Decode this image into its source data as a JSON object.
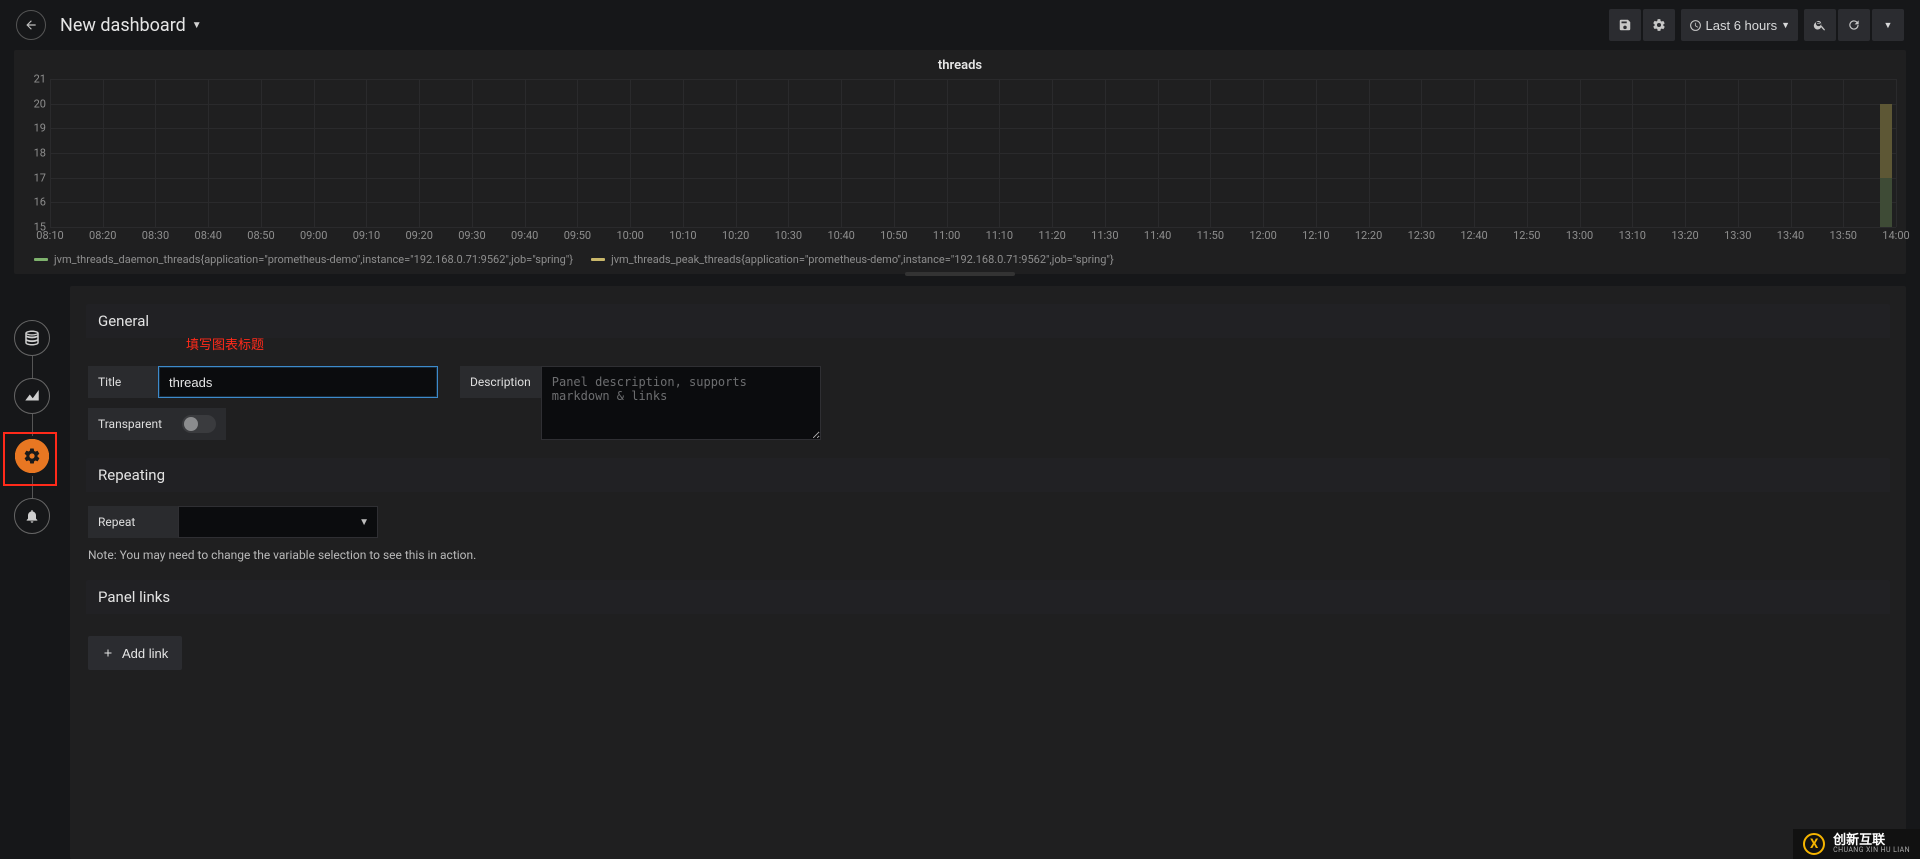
{
  "header": {
    "dashboard_title": "New dashboard",
    "save_tooltip": "Save",
    "settings_tooltip": "Settings",
    "time_range_label": "Last 6 hours",
    "zoom_out_tooltip": "Zoom out",
    "refresh_tooltip": "Refresh"
  },
  "chart_data": {
    "type": "bar",
    "title": "threads",
    "ylabel": "",
    "ylim": [
      15,
      21
    ],
    "y_ticks": [
      15,
      16,
      17,
      18,
      19,
      20,
      21
    ],
    "x_ticks": [
      "08:10",
      "08:20",
      "08:30",
      "08:40",
      "08:50",
      "09:00",
      "09:10",
      "09:20",
      "09:30",
      "09:40",
      "09:50",
      "10:00",
      "10:10",
      "10:20",
      "10:30",
      "10:40",
      "10:50",
      "11:00",
      "11:10",
      "11:20",
      "11:30",
      "11:40",
      "11:50",
      "12:00",
      "12:10",
      "12:20",
      "12:30",
      "12:40",
      "12:50",
      "13:00",
      "13:10",
      "13:20",
      "13:30",
      "13:40",
      "13:50",
      "14:00"
    ],
    "series": [
      {
        "name": "jvm_threads_daemon_threads{application=\"prometheus-demo\",instance=\"192.168.0.71:9562\",job=\"spring\"}",
        "color": "#7eb26d",
        "values_at_last_tick": 17
      },
      {
        "name": "jvm_threads_peak_threads{application=\"prometheus-demo\",instance=\"192.168.0.71:9562\",job=\"spring\"}",
        "color": "#c9b76a",
        "values_at_last_tick": 20
      }
    ],
    "note": "Only the final time bucket (~14:00) has visible bars; the rest of the range shows no data."
  },
  "side_rail": {
    "items": [
      {
        "id": "queries",
        "icon": "database-icon"
      },
      {
        "id": "visualization",
        "icon": "chart-icon"
      },
      {
        "id": "general",
        "icon": "gear-icon",
        "active": true
      },
      {
        "id": "alert",
        "icon": "bell-icon"
      }
    ]
  },
  "annotation_text": "填写图表标题",
  "general": {
    "heading": "General",
    "title_label": "Title",
    "title_value": "threads",
    "transparent_label": "Transparent",
    "description_label": "Description",
    "description_placeholder": "Panel description, supports markdown & links"
  },
  "repeating": {
    "heading": "Repeating",
    "repeat_label": "Repeat",
    "repeat_value": "",
    "note": "Note: You may need to change the variable selection to see this in action."
  },
  "panel_links": {
    "heading": "Panel links",
    "add_link_label": "Add link"
  },
  "watermark": {
    "cn": "创新互联",
    "en": "CHUANG XIN HU LIAN"
  }
}
